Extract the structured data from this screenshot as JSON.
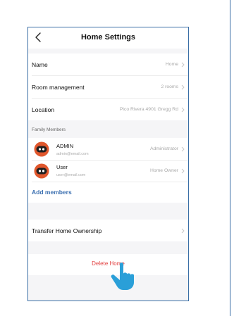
{
  "header": {
    "title": "Home Settings"
  },
  "rows": {
    "name": {
      "label": "Name",
      "value": "Home"
    },
    "rooms": {
      "label": "Room management",
      "value": "2 rooms"
    },
    "location": {
      "label": "Location",
      "value": "Pico Rivera 4901 Gregg Rd"
    }
  },
  "family": {
    "section_label": "Family Members",
    "members": [
      {
        "name": "ADMIN",
        "email": "admin@email.com",
        "role": "Administrator"
      },
      {
        "name": "User",
        "email": "user@email.com",
        "role": "Home Owner"
      }
    ],
    "add_label": "Add members"
  },
  "transfer": {
    "label": "Transfer Home Ownership"
  },
  "delete": {
    "label": "Delete Home"
  },
  "colors": {
    "accent": "#3b6fb0",
    "danger": "#e24040",
    "pointer": "#2a9fd8",
    "avatar": "#e0572d"
  },
  "icons": {
    "back": "chevron-left-icon",
    "row_arrow": "chevron-right-icon",
    "pointer": "hand-pointer-icon"
  }
}
